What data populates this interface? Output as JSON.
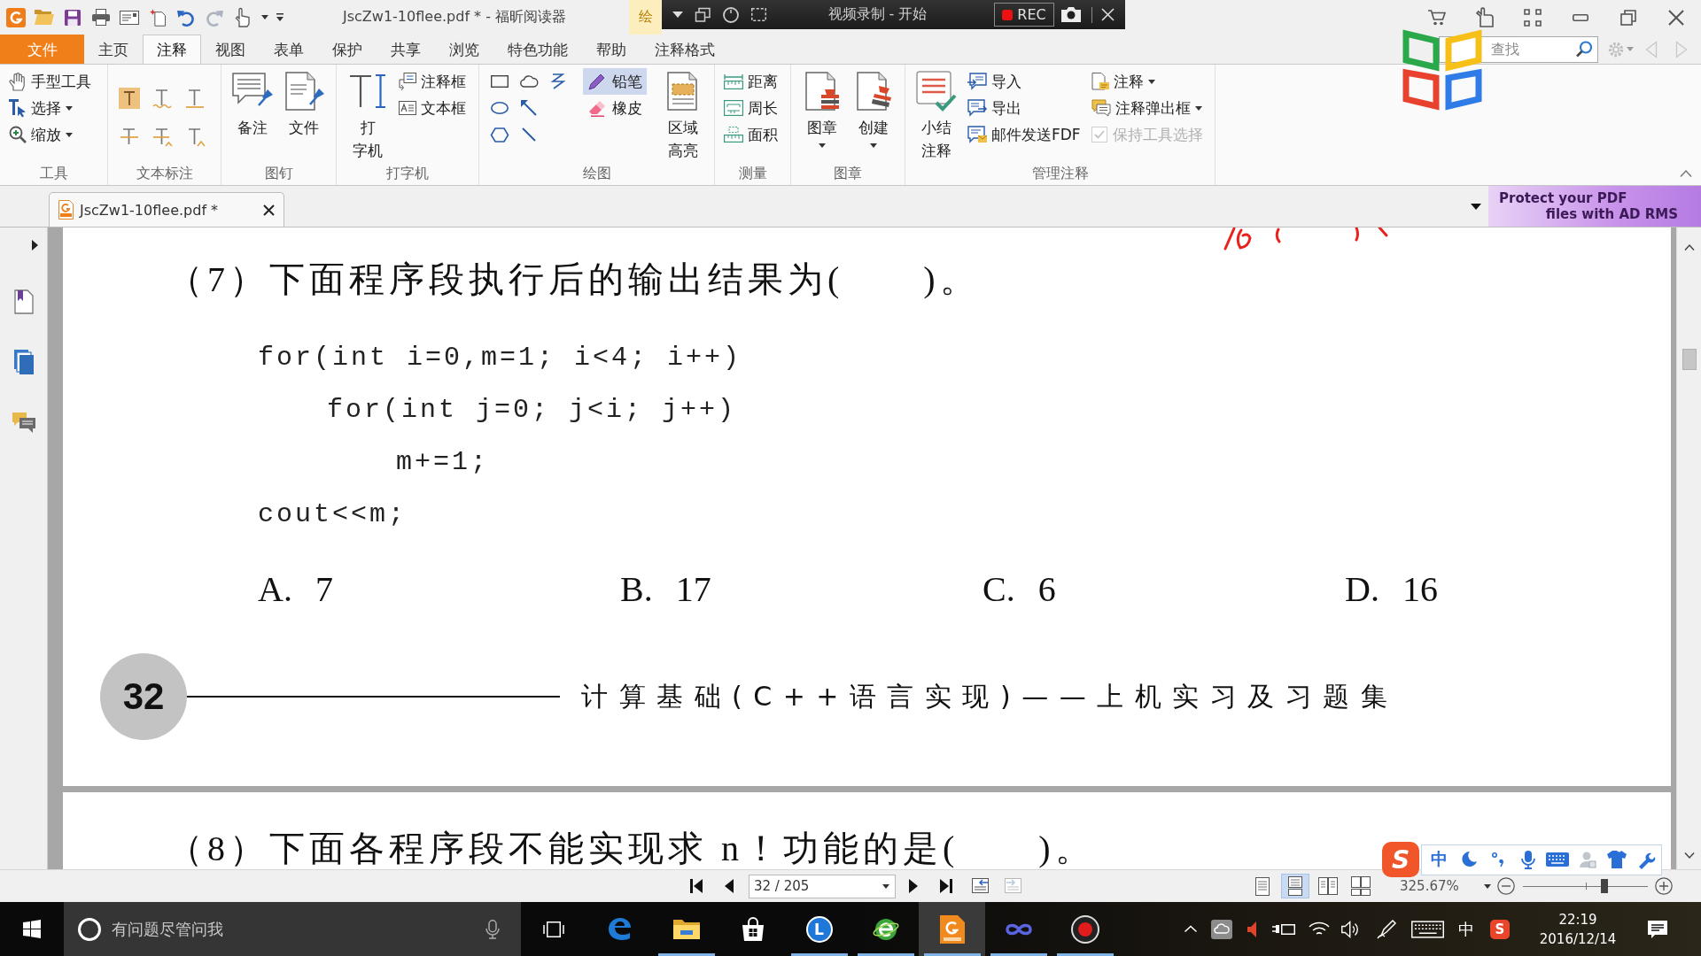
{
  "title_bar": {
    "title": "JscZw1-10flee.pdf * - 福昕阅读器",
    "contextual_tab": "绘"
  },
  "recorder_toolbar": {
    "title": "视频录制 - 开始",
    "record_label": "REC"
  },
  "menu_tabs": [
    {
      "label": "文件",
      "kind": "file",
      "selected": false
    },
    {
      "label": "主页",
      "kind": "tab",
      "selected": false
    },
    {
      "label": "注释",
      "kind": "tab",
      "selected": true
    },
    {
      "label": "视图",
      "kind": "tab",
      "selected": false
    },
    {
      "label": "表单",
      "kind": "tab",
      "selected": false
    },
    {
      "label": "保护",
      "kind": "tab",
      "selected": false
    },
    {
      "label": "共享",
      "kind": "tab",
      "selected": false
    },
    {
      "label": "浏览",
      "kind": "tab",
      "selected": false
    },
    {
      "label": "特色功能",
      "kind": "tab",
      "selected": false
    },
    {
      "label": "帮助",
      "kind": "tab",
      "selected": false
    },
    {
      "label": "注释格式",
      "kind": "tab",
      "selected": false
    }
  ],
  "search": {
    "placeholder": "查找"
  },
  "ribbon": {
    "groups": [
      {
        "label": "工具",
        "columns": [
          [
            {
              "kind": "small",
              "label": "手型工具"
            },
            {
              "kind": "small",
              "label": "选择",
              "dropdown": true
            },
            {
              "kind": "small",
              "label": "缩放",
              "dropdown": true
            }
          ]
        ]
      },
      {
        "label": "文本标注",
        "columns": [
          [
            {
              "kind": "icon"
            },
            {
              "kind": "icon"
            }
          ],
          [
            {
              "kind": "icon"
            },
            {
              "kind": "icon"
            }
          ],
          [
            {
              "kind": "icon"
            },
            {
              "kind": "icon"
            }
          ]
        ]
      },
      {
        "label": "图钉",
        "columns": [
          [
            {
              "kind": "large",
              "lines": [
                "备注"
              ]
            }
          ],
          [
            {
              "kind": "large",
              "lines": [
                "文件"
              ]
            }
          ]
        ]
      },
      {
        "label": "打字机",
        "columns": [
          [
            {
              "kind": "large",
              "lines": [
                "打",
                "字机"
              ]
            }
          ],
          [
            {
              "kind": "small",
              "label": "注释框"
            },
            {
              "kind": "small",
              "label": "文本框"
            }
          ]
        ]
      },
      {
        "label": "绘图",
        "columns": [
          [
            {
              "kind": "icon",
              "selected": false
            },
            {
              "kind": "icon",
              "selected": false
            },
            {
              "kind": "icon",
              "selected": false
            }
          ],
          [
            {
              "kind": "icon",
              "selected": false
            },
            {
              "kind": "icon",
              "selected": false
            },
            {
              "kind": "icon",
              "selected": false
            }
          ],
          [
            {
              "kind": "icon",
              "selected": false
            }
          ],
          [
            {
              "kind": "small",
              "label": "铅笔",
              "selected": true
            },
            {
              "kind": "small",
              "label": "橡皮",
              "selected": false
            }
          ],
          [
            {
              "kind": "large",
              "lines": [
                "区域",
                "高亮"
              ]
            }
          ]
        ]
      },
      {
        "label": "测量",
        "columns": [
          [
            {
              "kind": "small",
              "label": "距离"
            },
            {
              "kind": "small",
              "label": "周长"
            },
            {
              "kind": "small",
              "label": "面积"
            }
          ]
        ]
      },
      {
        "label": "图章",
        "columns": [
          [
            {
              "kind": "large",
              "lines": [
                "图章"
              ],
              "dropdown": true
            }
          ],
          [
            {
              "kind": "large",
              "lines": [
                "创建"
              ],
              "dropdown": true
            }
          ]
        ]
      },
      {
        "label": "管理注释",
        "columns": [
          [
            {
              "kind": "large",
              "lines": [
                "小结",
                "注释"
              ]
            }
          ],
          [
            {
              "kind": "small",
              "label": "导入"
            },
            {
              "kind": "small",
              "label": "导出"
            },
            {
              "kind": "small",
              "label": "邮件发送FDF"
            }
          ],
          [
            {
              "kind": "small",
              "label": "注释",
              "dropdown": true
            },
            {
              "kind": "small",
              "label": "注释弹出框",
              "dropdown": true
            },
            {
              "kind": "checkbox",
              "label": "保持工具选择",
              "checked": true,
              "disabled": true
            }
          ]
        ]
      }
    ]
  },
  "document_tabs": [
    {
      "title": "JscZw1-10flee.pdf *",
      "selected": true
    }
  ],
  "ad_banner": {
    "lines": [
      "Protect your PDF",
      "files with AD RMS"
    ]
  },
  "pages": [
    {
      "question": "（7）下面程序段执行后的输出结果为(　　)。",
      "code": [
        {
          "text": "for(int i=0,m=1; i<4; i++)",
          "children": [
            {
              "text": "for(int j=0; j<i; j++)",
              "children": [
                {
                  "text": "m+=1;"
                }
              ]
            }
          ]
        },
        {
          "text": "cout<<m;"
        }
      ],
      "options": [
        "A. 7",
        "B. 17",
        "C. 6",
        "D. 16"
      ],
      "footer": {
        "page_number": "32",
        "title": "计算基础(C++语言实现)——上机实习及习题集"
      }
    },
    {
      "question": "（8）下面各程序段不能实现求 n！功能的是(　　)。"
    }
  ],
  "status_bar": {
    "page_field": "32 / 205",
    "view_modes": [
      {
        "selected": false
      },
      {
        "selected": true
      },
      {
        "selected": false
      },
      {
        "selected": false
      }
    ],
    "zoom": {
      "value": "325.67%",
      "level": 0.65
    }
  },
  "ime_bar": {
    "logo": "S",
    "mode": "中"
  },
  "taskbar": {
    "search_placeholder": "有问题尽管问我",
    "apps": [
      {
        "running": false,
        "active": false
      },
      {
        "running": true,
        "active": false
      },
      {
        "running": false,
        "active": false
      },
      {
        "running": true,
        "active": false,
        "letter": "L"
      },
      {
        "running": true,
        "active": false
      },
      {
        "running": true,
        "active": true
      },
      {
        "running": true,
        "active": false
      },
      {
        "running": true,
        "active": false
      }
    ],
    "tray": {
      "input_mode": "中",
      "ime_logo": "S",
      "time": "22:19",
      "date": "2016/12/14"
    }
  }
}
